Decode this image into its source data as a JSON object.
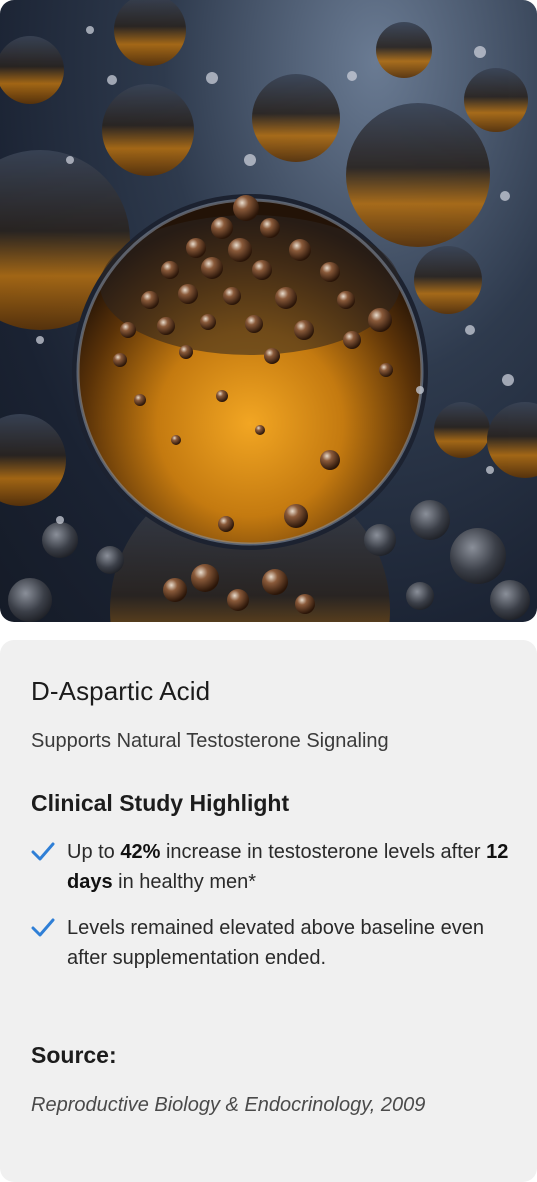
{
  "hero": {
    "image_subject": "amber oil droplets macro photo"
  },
  "card": {
    "title": "D-Aspartic Acid",
    "subtitle": "Supports Natural Testosterone Signaling",
    "section_heading": "Clinical Study Highlight",
    "bullets": [
      {
        "icon": "check-icon",
        "parts": [
          {
            "text": "Up to ",
            "bold": false
          },
          {
            "text": "42%",
            "bold": true
          },
          {
            "text": " increase in testosterone levels after ",
            "bold": false
          },
          {
            "text": "12 days",
            "bold": true
          },
          {
            "text": " in healthy men*",
            "bold": false
          }
        ]
      },
      {
        "icon": "check-icon",
        "parts": [
          {
            "text": "Levels remained elevated above baseline even after supplementation ended.",
            "bold": false
          }
        ]
      }
    ],
    "source_heading": "Source:",
    "source_text": "Reproductive Biology & Endocrinology, 2009"
  },
  "colors": {
    "card_bg": "#f0f0f0",
    "check": "#2f7fd6",
    "amber": "#d9931a"
  }
}
